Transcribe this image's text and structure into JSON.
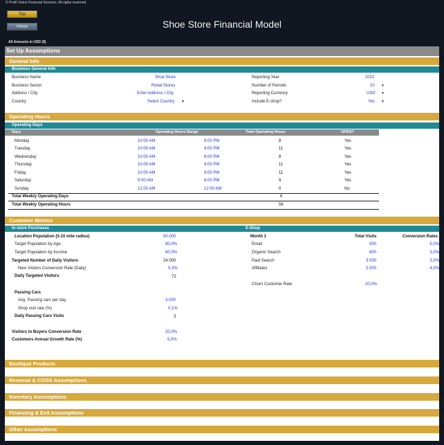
{
  "copyright": "© Profit Vision Financial Services. All rights reserved.",
  "nav": {
    "top": "Top",
    "home": "Home"
  },
  "title": "Shoe Store Financial Model",
  "amounts": "All Amounts in  USD ($)",
  "setup": "Set Up Assumptions",
  "general_info": {
    "header": "General Info",
    "sub": "Business General Info",
    "left": [
      {
        "label": "Business Name",
        "value": "Shoe Store"
      },
      {
        "label": "Business Sector",
        "value": "Retail Stores"
      },
      {
        "label": "Address / City",
        "value": "Enter Address / City"
      },
      {
        "label": "Country",
        "value": "Select Country"
      }
    ],
    "right": [
      {
        "label": "Reporting Year",
        "value": "2022"
      },
      {
        "label": "Number of Periods",
        "value": "10"
      },
      {
        "label": "Reporting Currency",
        "value": "USD"
      },
      {
        "label": "Include E-shop?",
        "value": "Yes"
      }
    ]
  },
  "operating": {
    "header": "Operating Hours",
    "sub": "Operating Days",
    "cols": {
      "days": "Days",
      "range": "Operating Hours Range",
      "total": "Total Operating Hours",
      "open": "OPEN?"
    },
    "rows": [
      {
        "day": "Monday",
        "from": "10:00 AM",
        "to": "6:00 PM",
        "hours": "8",
        "open": "Yes"
      },
      {
        "day": "Tuesday",
        "from": "10:00 AM",
        "to": "9:00 PM",
        "hours": "11",
        "open": "Yes"
      },
      {
        "day": "Wednesday",
        "from": "10:00 AM",
        "to": "6:00 PM",
        "hours": "8",
        "open": "Yes"
      },
      {
        "day": "Thursday",
        "from": "10:00 AM",
        "to": "9:00 PM",
        "hours": "11",
        "open": "Yes"
      },
      {
        "day": "Friday",
        "from": "10:00 AM",
        "to": "9:00 PM",
        "hours": "11",
        "open": "Yes"
      },
      {
        "day": "Saturday",
        "from": "9:00 AM",
        "to": "6:00 PM",
        "hours": "9",
        "open": "Yes"
      },
      {
        "day": "Sunday",
        "from": "12:00 AM",
        "to": "12:00 AM",
        "hours": "0",
        "open": "No"
      }
    ],
    "total_days_label": "Total Weekly Operating Days",
    "total_days": "6",
    "total_hours_label": "Total Weekly Operating Hours",
    "total_hours": "58"
  },
  "customer": {
    "header": "Customer Metrics",
    "instore": "In-store Purchases",
    "eshop": "E-Shop",
    "location_label": "Location Population (5-10 mile radius)",
    "location": "50.000",
    "target_age_label": "Target Population by Age",
    "target_age": "80,0%",
    "target_income_label": "Target Population by Income",
    "target_income": "60,0%",
    "targeted_label": "Targeted Number of Daily Visitors",
    "targeted": "24.000",
    "new_conv_label": "New Visitors Conversion Rate (Daily)",
    "new_conv": "0,3%",
    "daily_targeted_label": "Daily Targeted Visitors",
    "daily_targeted": "72",
    "passing_label": "Passing Cars",
    "avg_cars_label": "Avg. Passing cars per day",
    "avg_cars": "3.000",
    "shop_visit_label": "Shop visit rate (%)",
    "shop_visit": "0,1%",
    "daily_passing_label": "Daily Passing Cars Visits",
    "daily_passing": "3",
    "v2b_label": "Visitors to Buyers Conversion Rate",
    "v2b": "20,0%",
    "growth_label": "Customers Annual Growth Rate (%)",
    "growth": "5,0%",
    "eshop_cols": {
      "month": "Month 1",
      "visits": "Total Visits",
      "conv": "Conversion Rates"
    },
    "eshop_rows": [
      {
        "channel": "Email",
        "visits": "500",
        "conv": "5,0%"
      },
      {
        "channel": "Organic Search",
        "visits": "800",
        "conv": "3,0%"
      },
      {
        "channel": "Paid Search",
        "visits": "3.000",
        "conv": "3,0%"
      },
      {
        "channel": "Affiliates",
        "visits": "2.000",
        "conv": "4,0%"
      }
    ],
    "churn_label": "Churn Customer Rate",
    "churn": "20,0%"
  },
  "sections": [
    "Boutique Products",
    "Revenue & COGS Assumptions",
    "Inventory Assumptions",
    "Financing & Exit Assumptions",
    "Other Assumptions"
  ]
}
